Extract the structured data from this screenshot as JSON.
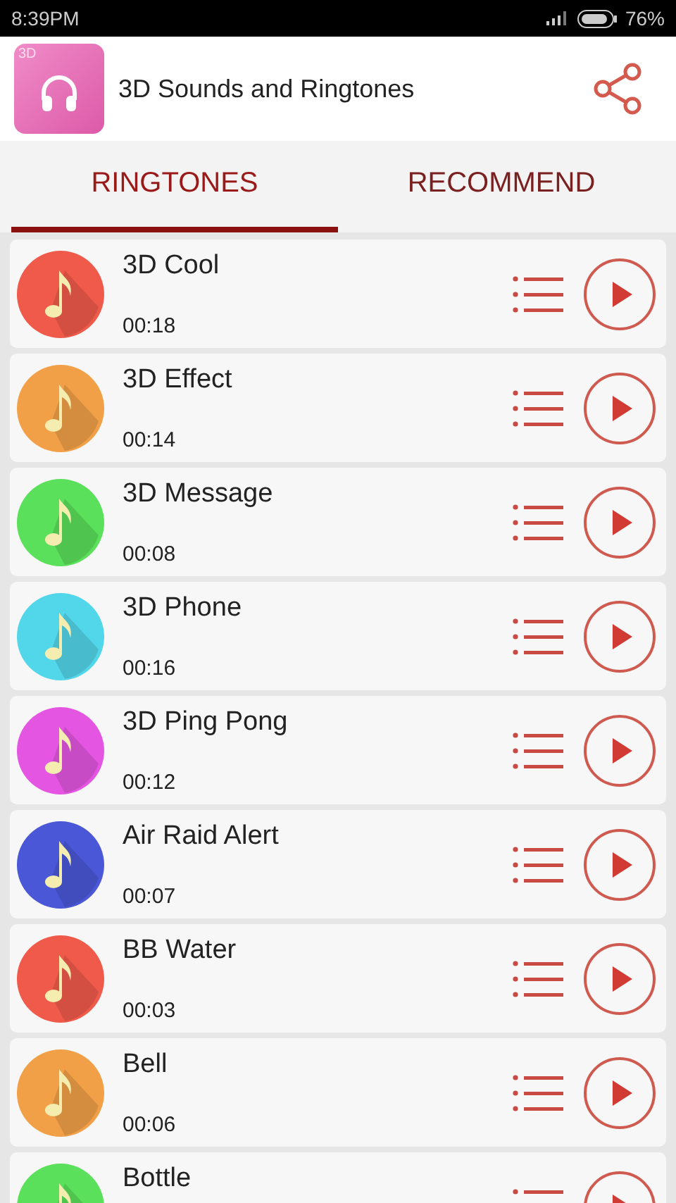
{
  "status_bar": {
    "time": "8:39PM",
    "battery": "76%"
  },
  "app_bar": {
    "title": "3D Sounds and Ringtones",
    "logo_badge": "3D"
  },
  "tabs": [
    {
      "label": "RINGTONES",
      "selected": true
    },
    {
      "label": "RECOMMEND",
      "selected": false
    }
  ],
  "ringtones": [
    {
      "name": "3D Cool",
      "duration": "00:18",
      "color": "#f05a4a"
    },
    {
      "name": "3D Effect",
      "duration": "00:14",
      "color": "#f2a048"
    },
    {
      "name": "3D Message",
      "duration": "00:08",
      "color": "#5ae05a"
    },
    {
      "name": "3D Phone",
      "duration": "00:16",
      "color": "#52d6ea"
    },
    {
      "name": "3D Ping Pong",
      "duration": "00:12",
      "color": "#e456e2"
    },
    {
      "name": "Air Raid Alert",
      "duration": "00:07",
      "color": "#4a58d8"
    },
    {
      "name": "BB Water",
      "duration": "00:03",
      "color": "#f05a4a"
    },
    {
      "name": "Bell",
      "duration": "00:06",
      "color": "#f2a048"
    },
    {
      "name": "Bottle",
      "color": "#5ae05a"
    }
  ]
}
